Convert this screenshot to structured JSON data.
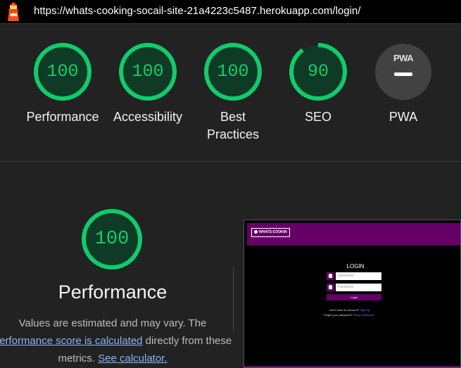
{
  "url_bar": {
    "url": "https://whats-cooking-socail-site-21a4223c5487.herokuapp.com/login/"
  },
  "colors": {
    "pass": "#0cce6b",
    "pass_bg": "#0f3a25",
    "pwa_bg": "#424242",
    "brand_purple": "#650066"
  },
  "gauges": [
    {
      "score": "100",
      "score_pct": 100,
      "label": "Performance"
    },
    {
      "score": "100",
      "score_pct": 100,
      "label": "Accessibility"
    },
    {
      "score": "100",
      "score_pct": 100,
      "label": "Best\nPractices"
    },
    {
      "score": "90",
      "score_pct": 90,
      "label": "SEO"
    },
    {
      "badge": "PWA",
      "label": "PWA"
    }
  ],
  "performance": {
    "score": "100",
    "title": "Performance",
    "desc_prefix": "Values are estimated and may vary. The",
    "link1": "performance score is calculated",
    "desc_mid": " directly from these metrics. ",
    "link2": "See calculator."
  },
  "screenshot": {
    "brand": "WHATS-COOKIN",
    "login_title": "LOGIN",
    "username_placeholder": "Username",
    "password_placeholder": "Password",
    "login_button": "Login",
    "no_account": "Don't have an account?",
    "signup_link": "Sign Up",
    "forgot": "Forgot your password?",
    "reset_link": "Reset Password"
  }
}
